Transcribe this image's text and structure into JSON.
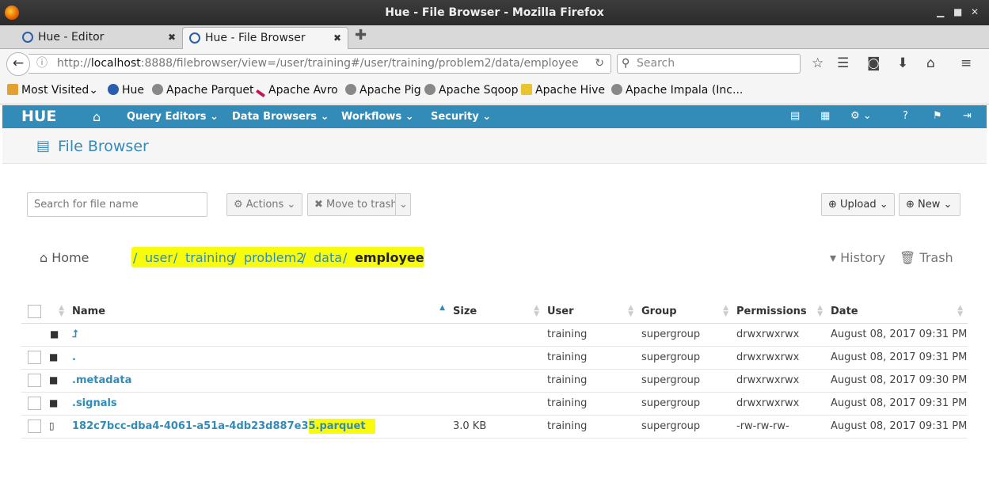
{
  "window": {
    "title": "Hue - File Browser - Mozilla Firefox"
  },
  "tabs": [
    {
      "label": "Hue - Editor"
    },
    {
      "label": "Hue - File Browser"
    }
  ],
  "address_bar": {
    "prefix": "http://",
    "host": "localhost",
    "rest": ":8888/filebrowser/view=/user/training#/user/training/problem2/data/employee"
  },
  "search": {
    "placeholder": "Search"
  },
  "bookmarks": [
    {
      "label": "Most Visited",
      "icon": "most-visited-icon"
    },
    {
      "label": "Hue",
      "icon": "hue-icon"
    },
    {
      "label": "Apache Parquet",
      "icon": "globe-icon"
    },
    {
      "label": "Apache Avro",
      "icon": "avro-icon"
    },
    {
      "label": "Apache Pig",
      "icon": "globe-icon"
    },
    {
      "label": "Apache Sqoop",
      "icon": "globe-icon"
    },
    {
      "label": "Apache Hive",
      "icon": "hive-icon"
    },
    {
      "label": "Apache Impala (Inc...",
      "icon": "globe-icon"
    }
  ],
  "hue_nav": {
    "logo": "HUE",
    "menus": [
      "Query Editors",
      "Data Browsers",
      "Workflows",
      "Security"
    ]
  },
  "page": {
    "title": "File Browser"
  },
  "toolbar": {
    "search_placeholder": "Search for file name",
    "actions": "Actions",
    "move_to_trash": "Move to trash",
    "upload": "Upload",
    "new": "New"
  },
  "breadcrumb": {
    "home": "Home",
    "parts": [
      "user",
      "training",
      "problem2",
      "data"
    ],
    "current": "employee",
    "history": "History",
    "trash": "Trash"
  },
  "table": {
    "columns": [
      "Name",
      "Size",
      "User",
      "Group",
      "Permissions",
      "Date"
    ],
    "rows": [
      {
        "name": "⮥",
        "type": "folder",
        "size": "",
        "user": "training",
        "group": "supergroup",
        "permissions": "drwxrwxrwx",
        "date": "August 08, 2017 09:31 PM"
      },
      {
        "name": ".",
        "type": "folder",
        "size": "",
        "user": "training",
        "group": "supergroup",
        "permissions": "drwxrwxrwx",
        "date": "August 08, 2017 09:31 PM"
      },
      {
        "name": ".metadata",
        "type": "folder",
        "size": "",
        "user": "training",
        "group": "supergroup",
        "permissions": "drwxrwxrwx",
        "date": "August 08, 2017 09:30 PM"
      },
      {
        "name": ".signals",
        "type": "folder",
        "size": "",
        "user": "training",
        "group": "supergroup",
        "permissions": "drwxrwxrwx",
        "date": "August 08, 2017 09:31 PM"
      },
      {
        "name_a": "182c7bcc-dba4-4061-a51a-4db23d887e3",
        "name_b": "5.parquet",
        "type": "file",
        "size": "3.0 KB",
        "user": "training",
        "group": "supergroup",
        "permissions": "-rw-rw-rw-",
        "date": "August 08, 2017 09:31 PM"
      }
    ]
  },
  "colors": {
    "hue_blue": "#338bb8",
    "highlight": "#f8fb0a"
  }
}
